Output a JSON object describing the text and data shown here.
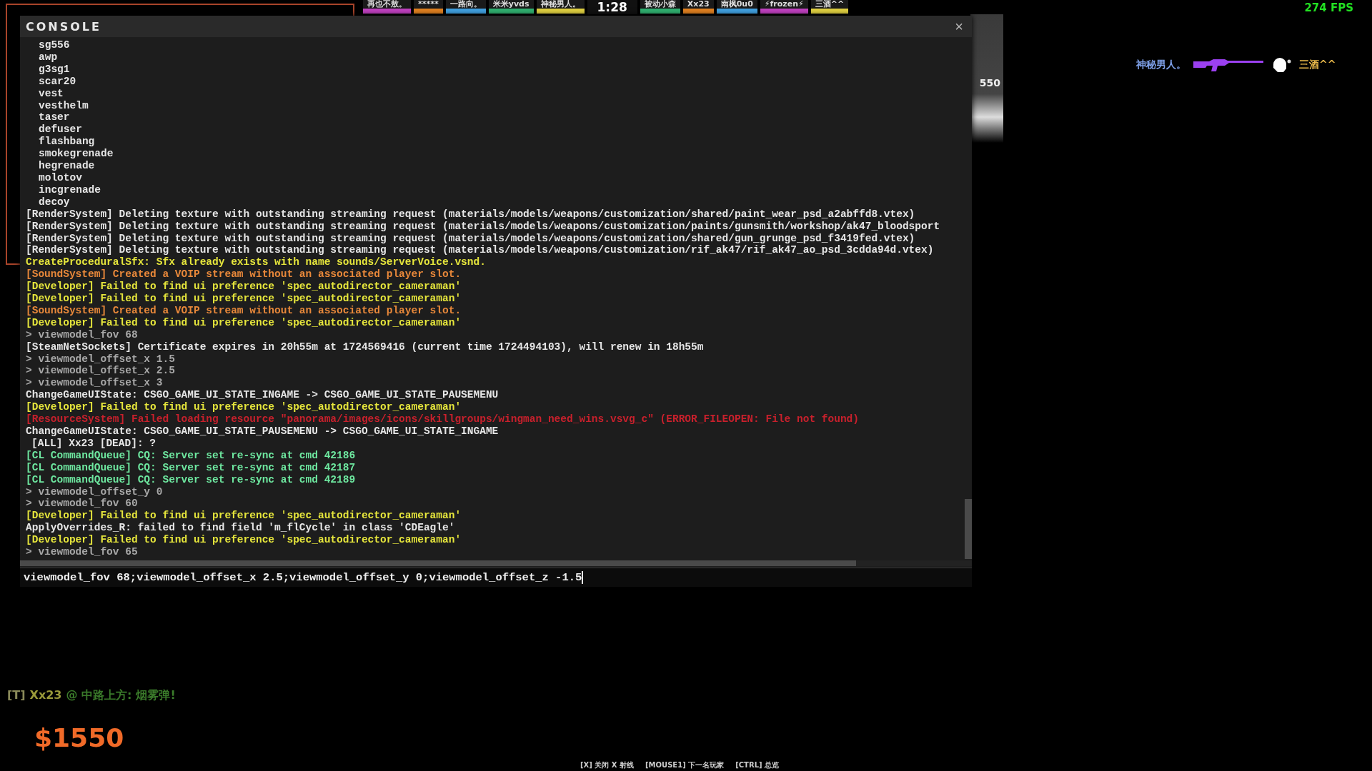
{
  "scoreboard": {
    "timer": "1:28",
    "players": [
      {
        "name": "再也不敖。",
        "color": "#c040c0"
      },
      {
        "name": "*****",
        "color": "#e08020"
      },
      {
        "name": "一路向。",
        "color": "#40a0e0"
      },
      {
        "name": "米米yvds",
        "color": "#30b070"
      },
      {
        "name": "神秘男人。",
        "color": "#e0d040"
      },
      {
        "name": "被动小森",
        "color": "#30b070"
      },
      {
        "name": "Xx23",
        "color": "#e08020"
      },
      {
        "name": "南枫0u0",
        "color": "#40a0e0"
      },
      {
        "name": "⚡frozen⚡",
        "color": "#c040c0"
      },
      {
        "name": "三酒^^",
        "color": "#e0d040"
      }
    ]
  },
  "fps": "274 FPS",
  "killfeed": {
    "attacker": "神秘男人。",
    "victim": "三酒^^",
    "headshot": true
  },
  "spectator_panel": {
    "money": "550"
  },
  "console": {
    "title": "CONSOLE",
    "close": "×",
    "lines": [
      {
        "kind": "item",
        "text": "sg556"
      },
      {
        "kind": "item",
        "text": "awp"
      },
      {
        "kind": "item",
        "text": "g3sg1"
      },
      {
        "kind": "item",
        "text": "scar20"
      },
      {
        "kind": "item",
        "text": "vest"
      },
      {
        "kind": "item",
        "text": "vesthelm"
      },
      {
        "kind": "item",
        "text": "taser"
      },
      {
        "kind": "item",
        "text": "defuser"
      },
      {
        "kind": "item",
        "text": "flashbang"
      },
      {
        "kind": "item",
        "text": "smokegrenade"
      },
      {
        "kind": "item",
        "text": "hegrenade"
      },
      {
        "kind": "item",
        "text": "molotov"
      },
      {
        "kind": "item",
        "text": "incgrenade"
      },
      {
        "kind": "item",
        "text": "decoy"
      },
      {
        "kind": "normal",
        "text": "[RenderSystem] Deleting texture with outstanding streaming request (materials/models/weapons/customization/shared/paint_wear_psd_a2abffd8.vtex)"
      },
      {
        "kind": "normal",
        "text": "[RenderSystem] Deleting texture with outstanding streaming request (materials/models/weapons/customization/paints/gunsmith/workshop/ak47_bloodsport"
      },
      {
        "kind": "normal",
        "text": "[RenderSystem] Deleting texture with outstanding streaming request (materials/models/weapons/customization/shared/gun_grunge_psd_f3419fed.vtex)"
      },
      {
        "kind": "normal",
        "text": "[RenderSystem] Deleting texture with outstanding streaming request (materials/models/weapons/customization/rif_ak47/rif_ak47_ao_psd_3cdda94d.vtex)"
      },
      {
        "kind": "warning",
        "text": "CreateProceduralSfx: Sfx already exists with name sounds/ServerVoice.vsnd."
      },
      {
        "kind": "sound",
        "text": "[SoundSystem] Created a VOIP stream without an associated player slot."
      },
      {
        "kind": "warning",
        "text": "[Developer] Failed to find ui preference 'spec_autodirector_cameraman'"
      },
      {
        "kind": "warning",
        "text": "[Developer] Failed to find ui preference 'spec_autodirector_cameraman'"
      },
      {
        "kind": "sound",
        "text": "[SoundSystem] Created a VOIP stream without an associated player slot."
      },
      {
        "kind": "warning",
        "text": "[Developer] Failed to find ui preference 'spec_autodirector_cameraman'"
      },
      {
        "kind": "command",
        "text": "> viewmodel_fov 68"
      },
      {
        "kind": "normal",
        "text": "[SteamNetSockets] Certificate expires in 20h55m at 1724569416 (current time 1724494103), will renew in 18h55m"
      },
      {
        "kind": "command",
        "text": "> viewmodel_offset_x 1.5"
      },
      {
        "kind": "command",
        "text": "> viewmodel_offset_x 2.5"
      },
      {
        "kind": "command",
        "text": "> viewmodel_offset_x 3"
      },
      {
        "kind": "normal",
        "text": "ChangeGameUIState: CSGO_GAME_UI_STATE_INGAME -> CSGO_GAME_UI_STATE_PAUSEMENU"
      },
      {
        "kind": "warning",
        "text": "[Developer] Failed to find ui preference 'spec_autodirector_cameraman'"
      },
      {
        "kind": "error",
        "text": "[ResourceSystem] Failed loading resource \"panorama/images/icons/skillgroups/wingman_need_wins.vsvg_c\" (ERROR_FILEOPEN: File not found)"
      },
      {
        "kind": "normal",
        "text": "ChangeGameUIState: CSGO_GAME_UI_STATE_PAUSEMENU -> CSGO_GAME_UI_STATE_INGAME"
      },
      {
        "kind": "chat",
        "text": "[ALL] Xx23 [DEAD]: ?"
      },
      {
        "kind": "net",
        "text": "[CL CommandQueue] CQ: Server set re-sync at cmd 42186"
      },
      {
        "kind": "net",
        "text": "[CL CommandQueue] CQ: Server set re-sync at cmd 42187"
      },
      {
        "kind": "net",
        "text": "[CL CommandQueue] CQ: Server set re-sync at cmd 42189"
      },
      {
        "kind": "command",
        "text": "> viewmodel_offset_y 0"
      },
      {
        "kind": "command",
        "text": "> viewmodel_fov 60"
      },
      {
        "kind": "warning",
        "text": "[Developer] Failed to find ui preference 'spec_autodirector_cameraman'"
      },
      {
        "kind": "normal",
        "text": "ApplyOverrides_R: failed to find field 'm_flCycle' in class 'CDEagle'"
      },
      {
        "kind": "warning",
        "text": "[Developer] Failed to find ui preference 'spec_autodirector_cameraman'"
      },
      {
        "kind": "command",
        "text": "> viewmodel_fov 65"
      }
    ],
    "input": "viewmodel_fov 68;viewmodel_offset_x 2.5;viewmodel_offset_y 0;viewmodel_offset_z -1.5"
  },
  "chat": {
    "team": "[T]",
    "player": "Xx23",
    "location": "@ 中路上方:",
    "message": "烟雾弹!"
  },
  "money": "$1550",
  "hints": [
    "[X] 关闭 X 射线",
    "[MOUSE1] 下一名玩家",
    "[CTRL] 总览"
  ]
}
